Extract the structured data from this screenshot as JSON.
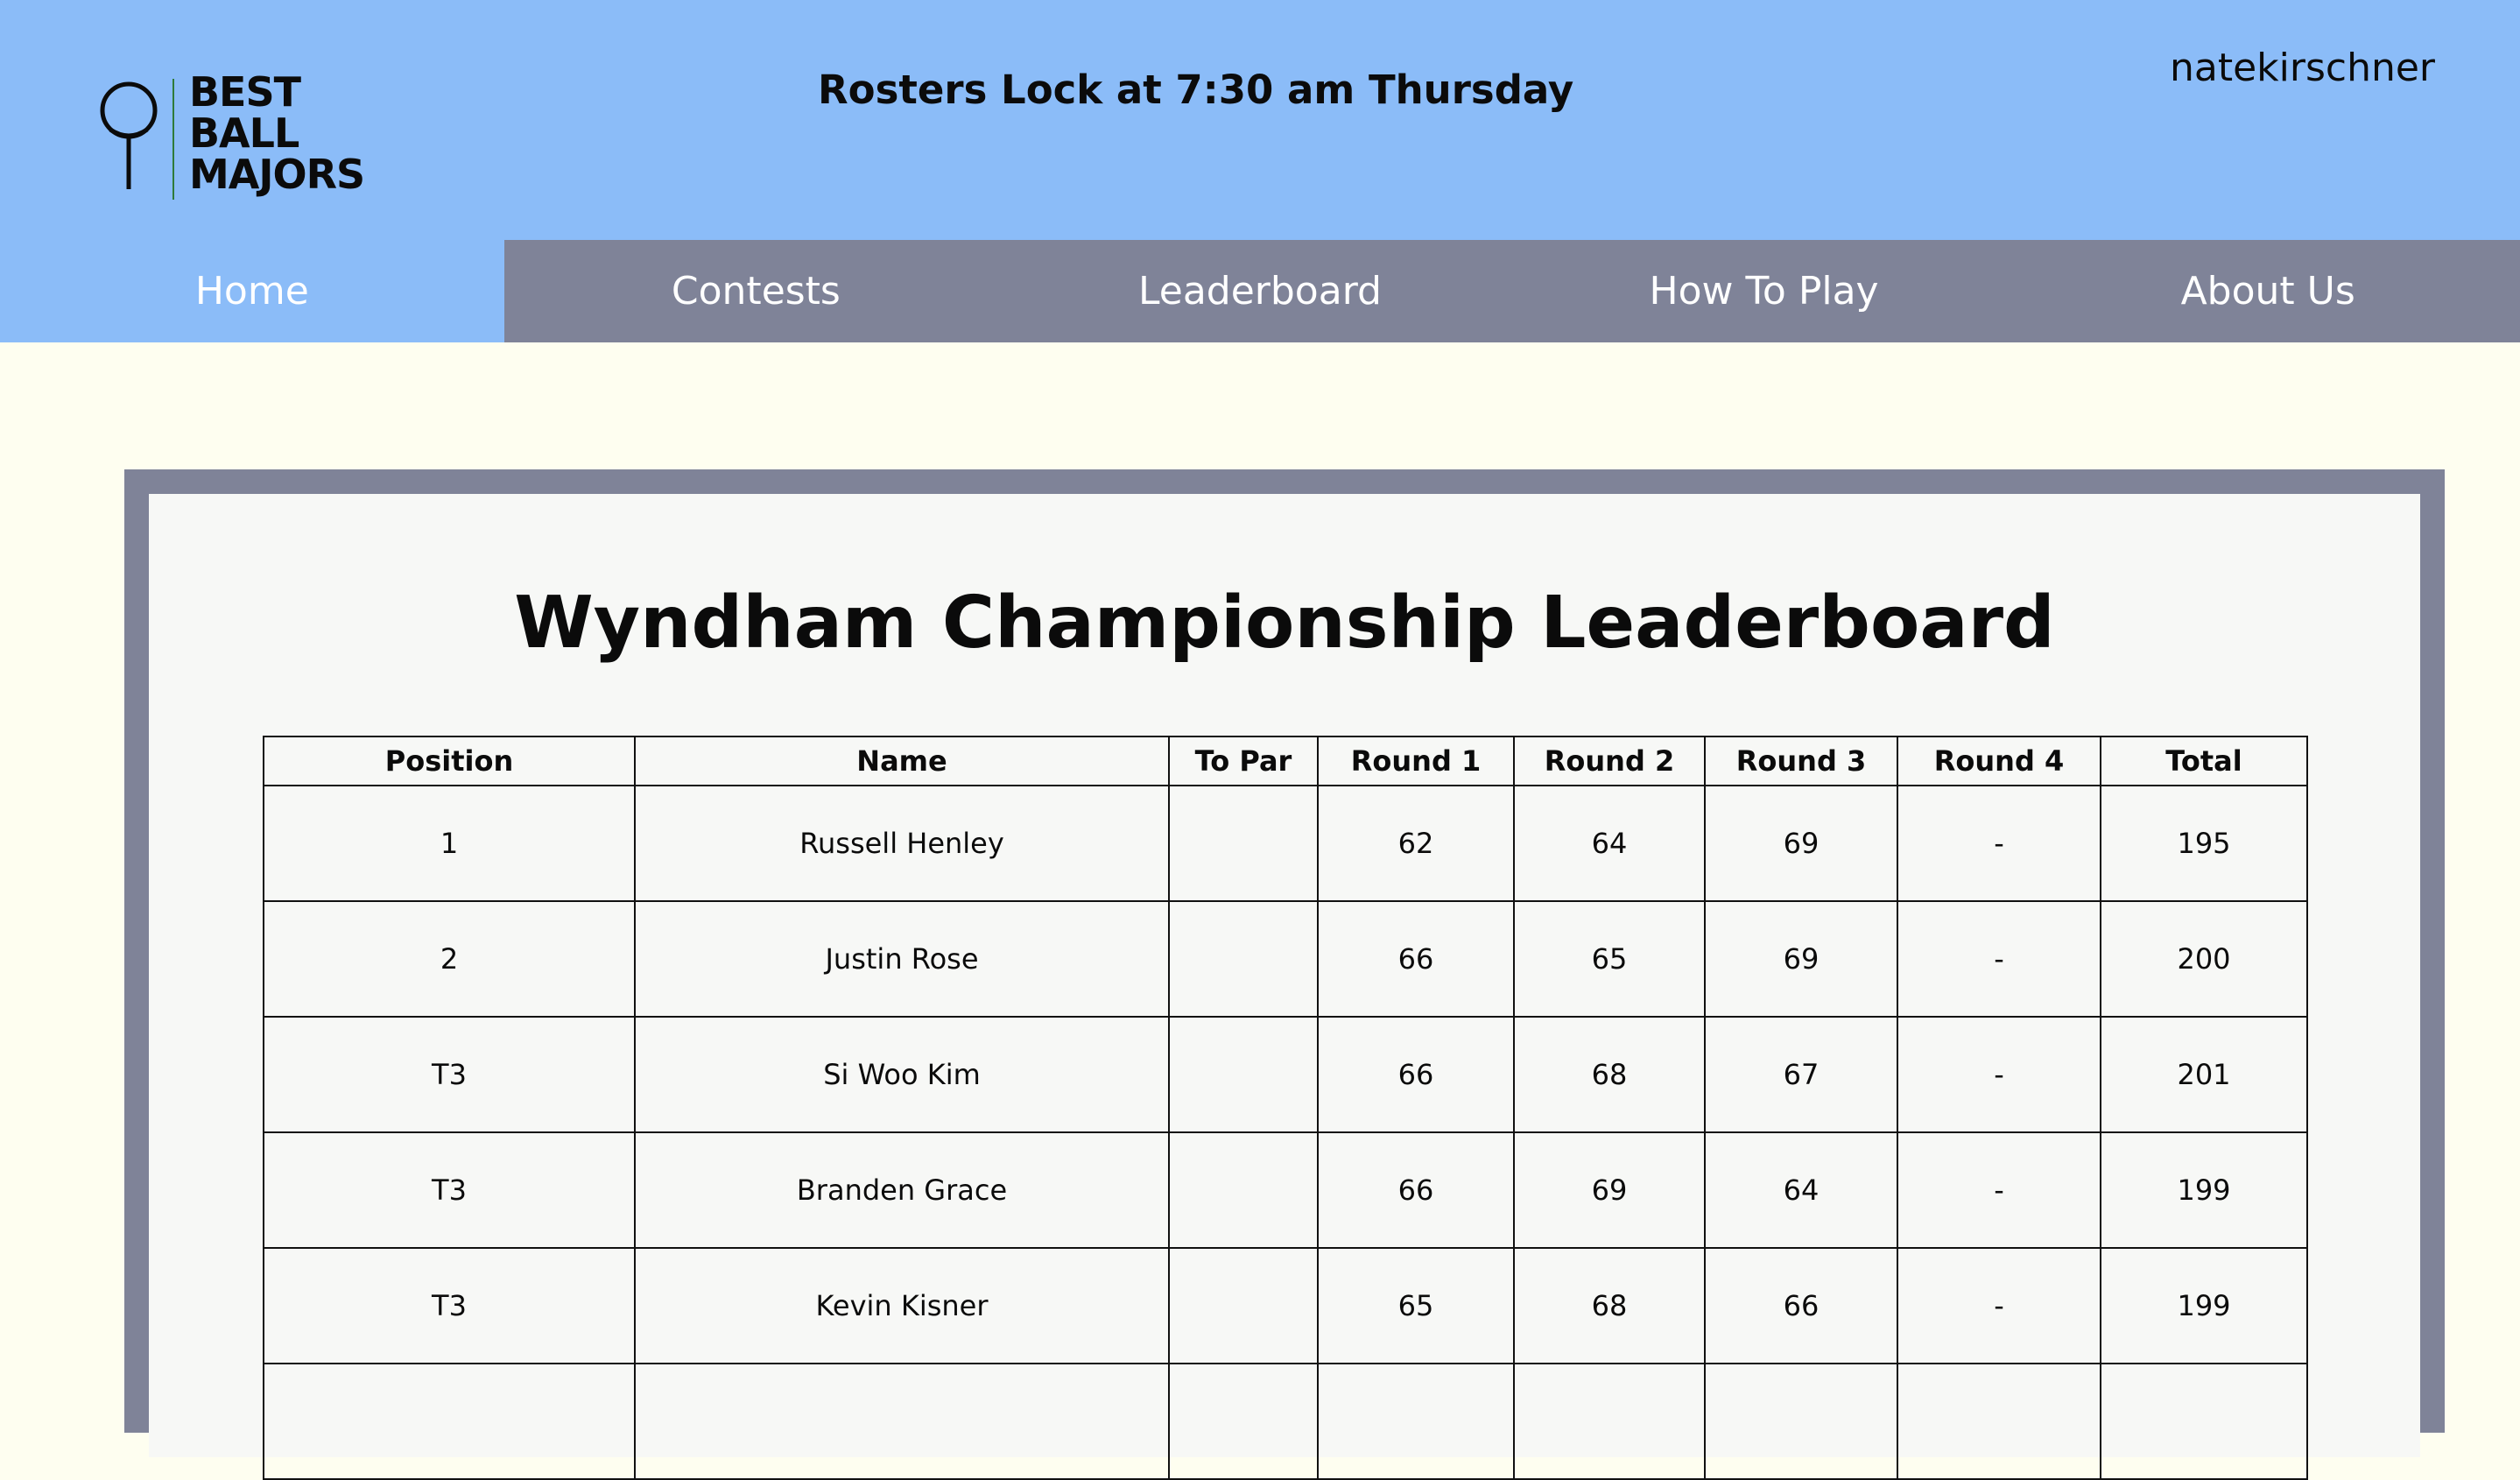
{
  "logo": {
    "lines": [
      "BEST",
      "BALL",
      "MAJORS"
    ],
    "icon": "golf-ball-on-tee-icon"
  },
  "header": {
    "lock_message": "Rosters Lock at 7:30 am Thursday",
    "username": "natekirschner"
  },
  "nav": {
    "items": [
      {
        "label": "Home",
        "active": true
      },
      {
        "label": "Contests",
        "active": false
      },
      {
        "label": "Leaderboard",
        "active": false
      },
      {
        "label": "How To Play",
        "active": false
      },
      {
        "label": "About Us",
        "active": false
      }
    ]
  },
  "leaderboard": {
    "title": "Wyndham Championship Leaderboard",
    "columns": [
      "Position",
      "Name",
      "To Par",
      "Round 1",
      "Round 2",
      "Round 3",
      "Round 4",
      "Total"
    ],
    "rows": [
      [
        "1",
        "Russell Henley",
        "",
        "62",
        "64",
        "69",
        "-",
        "195"
      ],
      [
        "2",
        "Justin Rose",
        "",
        "66",
        "65",
        "69",
        "-",
        "200"
      ],
      [
        "T3",
        "Si Woo Kim",
        "",
        "66",
        "68",
        "67",
        "-",
        "201"
      ],
      [
        "T3",
        "Branden Grace",
        "",
        "66",
        "69",
        "64",
        "-",
        "199"
      ],
      [
        "T3",
        "Kevin Kisner",
        "",
        "65",
        "68",
        "66",
        "-",
        "199"
      ],
      [
        "",
        "",
        "",
        "",
        "",
        "",
        "",
        ""
      ]
    ]
  },
  "colors": {
    "header_bg": "#8bbcf8",
    "nav_bg": "#7f8398",
    "page_bg": "#fefef0",
    "panel_bg": "#f7f8f6"
  }
}
